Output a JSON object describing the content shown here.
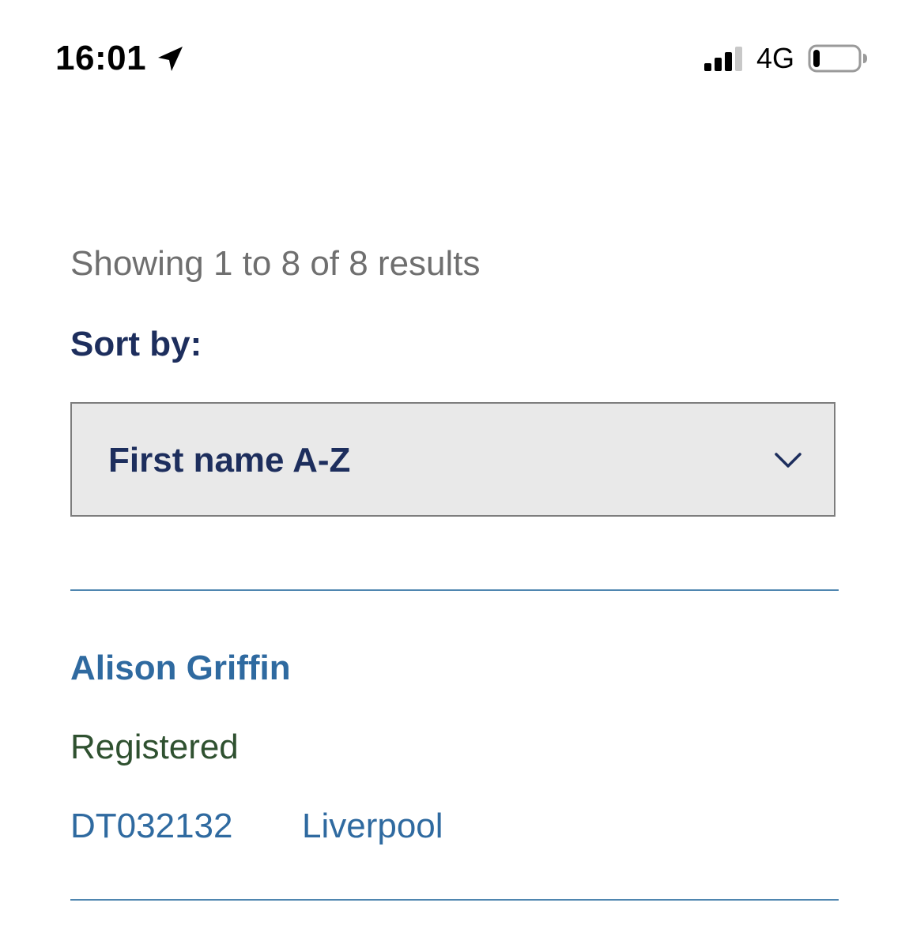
{
  "status_bar": {
    "time": "16:01",
    "network": "4G",
    "icons": {
      "location": "location-arrow-icon",
      "signal": "cellular-signal-icon",
      "battery": "battery-icon"
    },
    "battery_level": 0.15,
    "signal_bars_active": 3,
    "signal_bars_total": 4
  },
  "results": {
    "summary": "Showing 1 to 8 of 8 results",
    "sort_label": "Sort by:",
    "sort_selected": "First name A-Z",
    "items": [
      {
        "name": "Alison Griffin",
        "status": "Registered",
        "id": "DT032132",
        "location": "Liverpool"
      }
    ]
  },
  "colors": {
    "heading_navy": "#1d2e5d",
    "link_blue": "#2f6aa0",
    "status_green": "#2f5130",
    "muted_gray": "#6f6f6f",
    "divider_blue": "#4f86b0",
    "select_bg": "#e9e9e9"
  }
}
